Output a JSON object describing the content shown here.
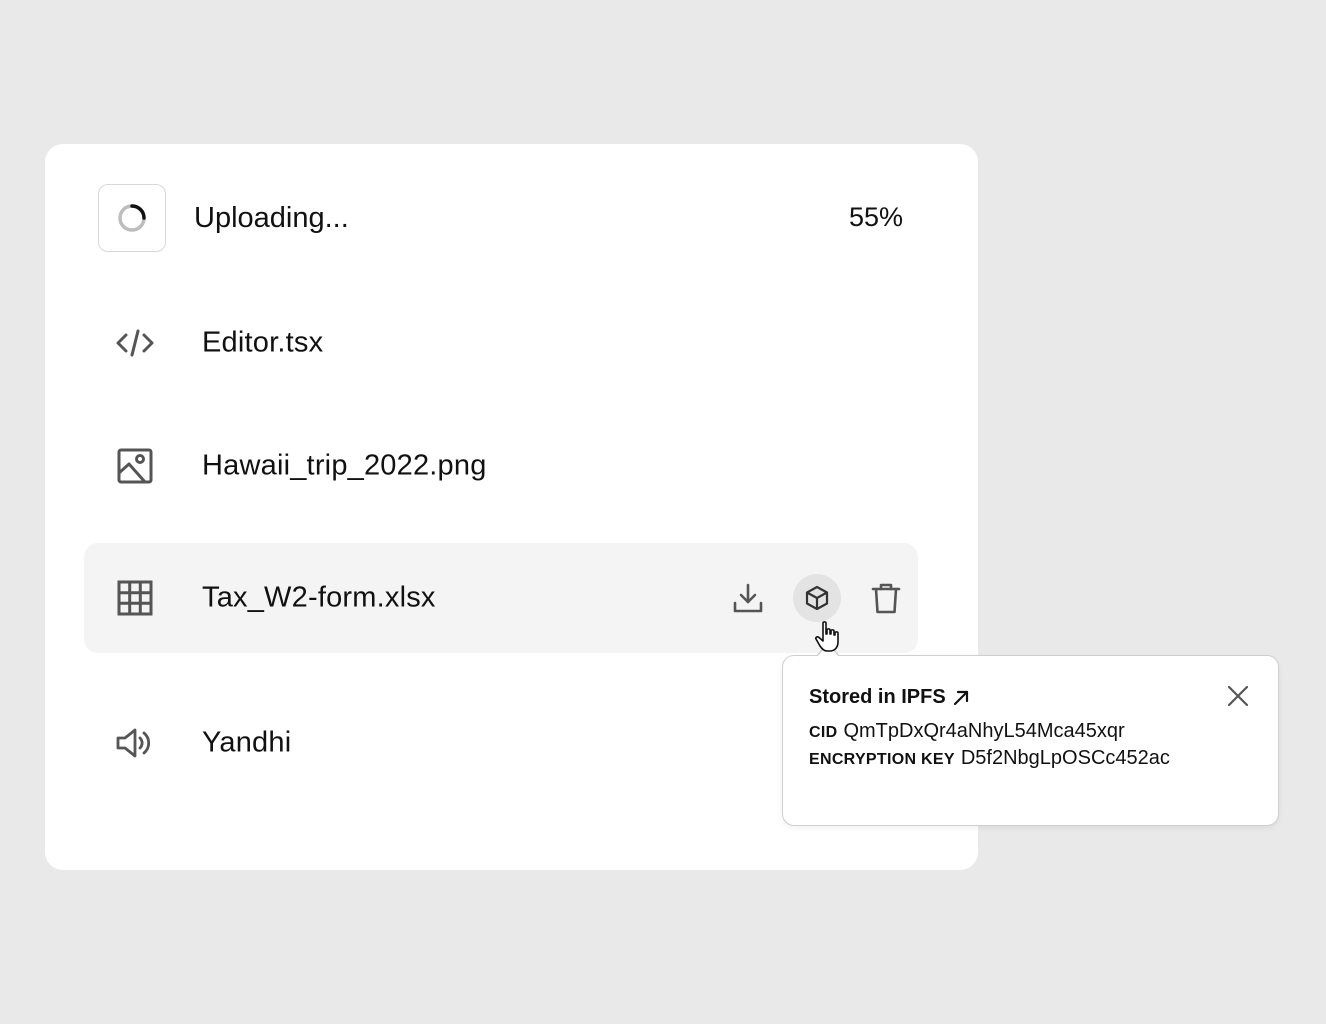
{
  "upload": {
    "status_label": "Uploading...",
    "progress_text": "55%",
    "progress": 0.55
  },
  "files": [
    {
      "name": "Editor.tsx",
      "icon": "code-icon"
    },
    {
      "name": "Hawaii_trip_2022.png",
      "icon": "image-icon"
    },
    {
      "name": "Tax_W2-form.xlsx",
      "icon": "spreadsheet-icon"
    },
    {
      "name": "Yandhi",
      "icon": "speaker-icon"
    }
  ],
  "actions": [
    {
      "name": "download",
      "icon": "download-icon"
    },
    {
      "name": "ipfs",
      "icon": "box-icon"
    },
    {
      "name": "delete",
      "icon": "trash-icon"
    }
  ],
  "popover": {
    "title": "Stored in IPFS",
    "cid_label": "CID",
    "cid_value": "QmTpDxQr4aNhyL54Mca45xqr",
    "key_label": "ENCRYPTION KEY",
    "key_value": "D5f2NbgLpOSCc452ac"
  },
  "colors": {
    "background": "#e9e9e9",
    "panel": "#ffffff",
    "row_hover": "#f4f4f4",
    "icon": "#555555"
  }
}
